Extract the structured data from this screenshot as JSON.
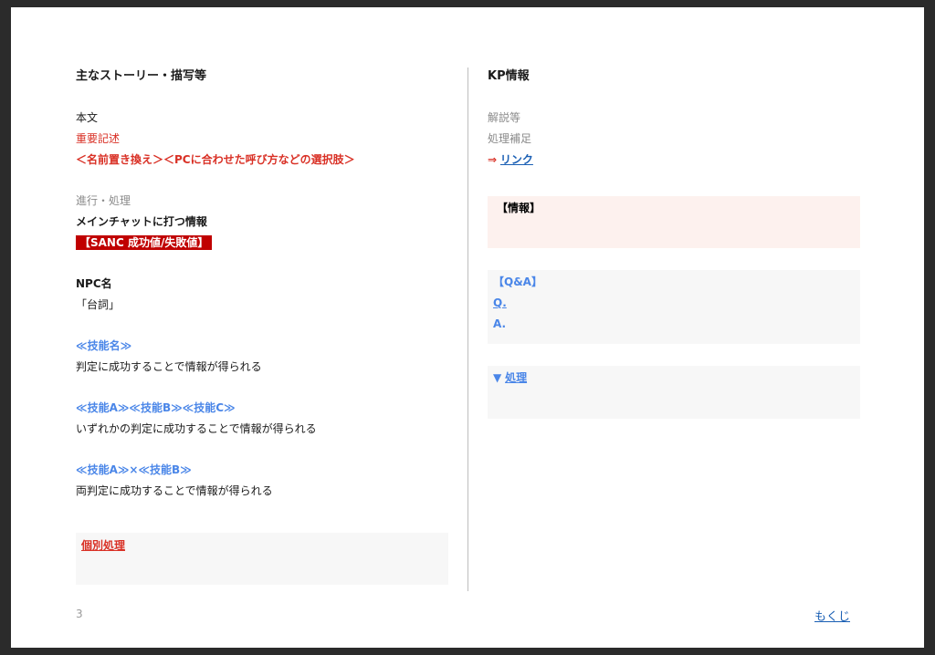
{
  "left": {
    "heading": "主なストーリー・描写等",
    "body_text": "本文",
    "important": "重要記述",
    "replace_note": "＜名前置き換え＞＜PCに合わせた呼び方などの選択肢＞",
    "progress": "進行・処理",
    "main_chat": "メインチャットに打つ情報",
    "sanc_badge": "【SANC 成功値/失敗値】",
    "npc_name": "NPC名",
    "dialogue": "「台詞」",
    "skill_name": "≪技能名≫",
    "skill_result": "判定に成功することで情報が得られる",
    "skill_multi": "≪技能A≫≪技能B≫≪技能C≫",
    "skill_multi_result": "いずれかの判定に成功することで情報が得られる",
    "skill_both": "≪技能A≫×≪技能B≫",
    "skill_both_result": "両判定に成功することで情報が得られる",
    "individual_box_label": "個別処理"
  },
  "right": {
    "heading": "KP情報",
    "explanation": "解説等",
    "processing_note": "処理補足",
    "arrow": "⇒",
    "link_label": "リンク",
    "info_box_label": "【情報】",
    "qa_label": "【Q&A】",
    "q": "Q.",
    "a": "A.",
    "triangle": "▼",
    "process_label": "処理"
  },
  "footer": {
    "page_number": "3",
    "toc_link": "もくじ"
  }
}
